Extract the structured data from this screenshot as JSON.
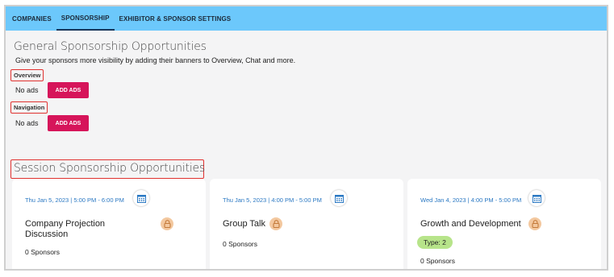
{
  "tabs": [
    {
      "label": "COMPANIES"
    },
    {
      "label": "SPONSORSHIP"
    },
    {
      "label": "EXHIBITOR & SPONSOR SETTINGS"
    }
  ],
  "general": {
    "title": "General Sponsorship Opportunities",
    "description": "Give your sponsors more visibility by adding their banners to Overview, Chat and more.",
    "overview": {
      "label": "Overview",
      "status": "No ads",
      "button": "ADD ADS"
    },
    "navigation": {
      "label": "Navigation",
      "status": "No ads",
      "button": "ADD ADS"
    }
  },
  "session": {
    "title": "Session Sponsorship Opportunities",
    "cards": [
      {
        "date": "Thu Jan 5, 2023 | 5:00 PM  -  6:00 PM",
        "title": "Company Projection Discussion",
        "sponsors": "0 Sponsors"
      },
      {
        "date": "Thu Jan 5, 2023 | 4:00 PM  -  5:00 PM",
        "title": "Group Talk",
        "sponsors": "0 Sponsors"
      },
      {
        "date": "Wed Jan 4, 2023 | 4:00 PM  -  5:00 PM",
        "title": "Growth and Development",
        "type": "Type: 2",
        "sponsors": "0 Sponsors"
      }
    ]
  },
  "colors": {
    "tabbar": "#6cc8fb",
    "button": "#d6155a",
    "highlight": "#e0312f",
    "date": "#2a78c3",
    "chip": "#b7e48a",
    "lock": "#f3c89f"
  },
  "icons": [
    "calendar-icon",
    "lock-icon"
  ]
}
